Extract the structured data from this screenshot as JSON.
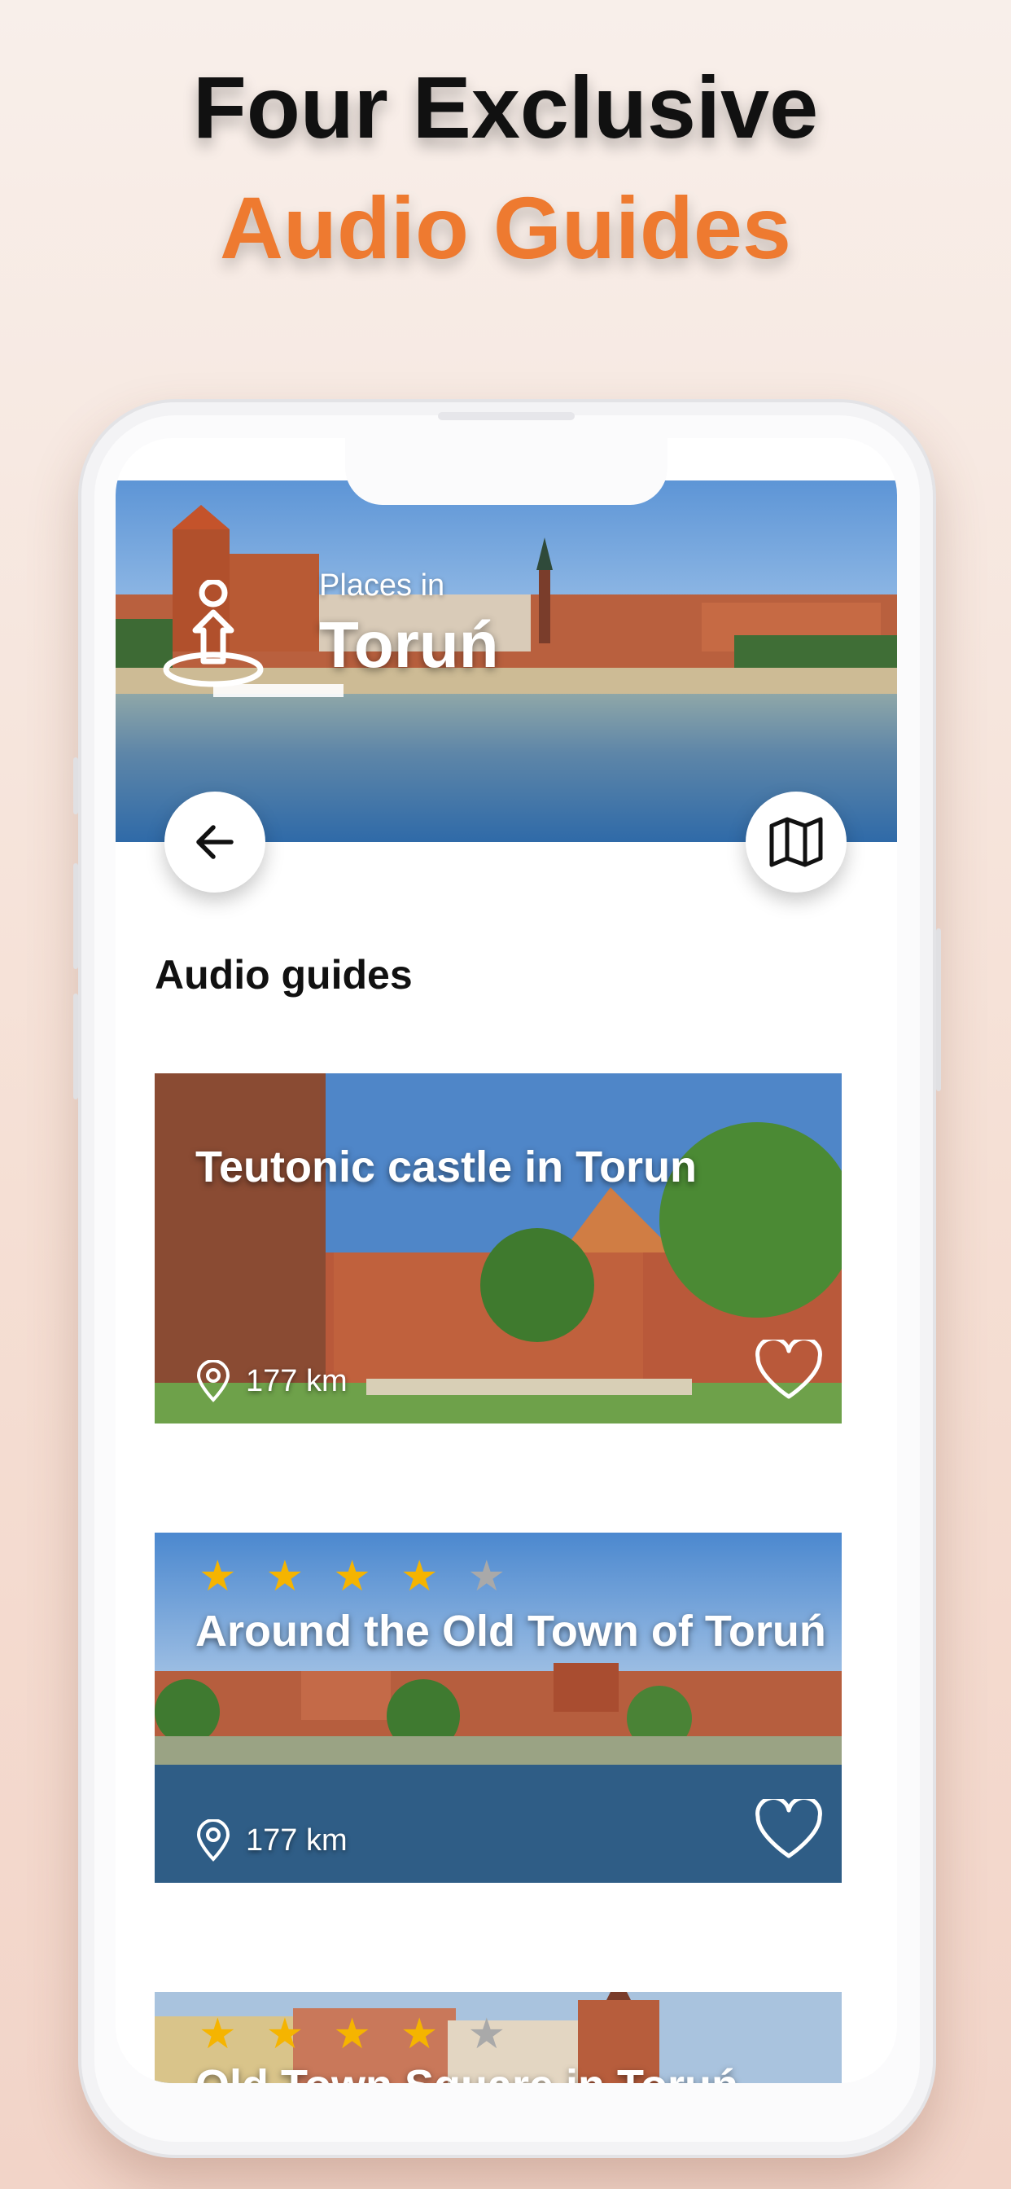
{
  "headline": {
    "line1": "Four Exclusive",
    "line2": "Audio Guides"
  },
  "colors": {
    "accent": "#ee7a30",
    "star_on": "#f5b400",
    "star_off": "#a9a9a9"
  },
  "hero": {
    "subtitle": "Places in",
    "city": "Toruń"
  },
  "buttons": {
    "back_icon": "arrow-left-icon",
    "map_icon": "map-icon"
  },
  "section": {
    "title": "Audio guides"
  },
  "guides": [
    {
      "title": "Teutonic castle in Torun",
      "distance": "177 km",
      "rating": null
    },
    {
      "title": "Around the Old Town of Toruń",
      "distance": "177 km",
      "rating": 4
    },
    {
      "title": "Old Town Square in Toruń",
      "distance": "",
      "rating": 4
    }
  ]
}
